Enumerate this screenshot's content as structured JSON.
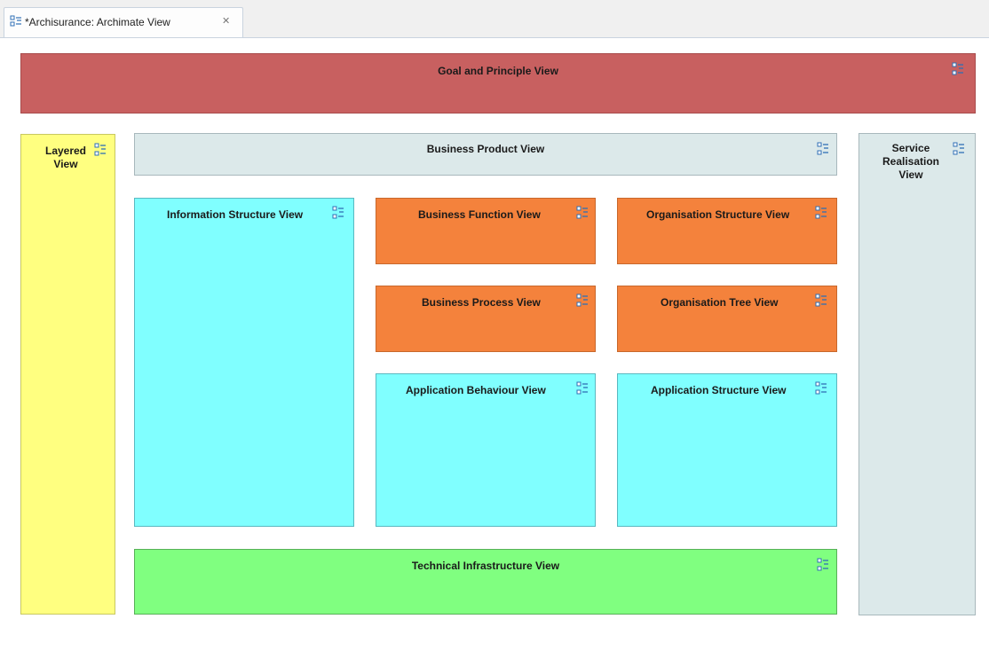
{
  "editor": {
    "tab_title": "*Archisurance: Archimate View",
    "tab_icon": "diagram-model-icon",
    "close_icon": "close-icon"
  },
  "diagram": {
    "goal_principle": "Goal and Principle View",
    "layered_line1": "Layered",
    "layered_line2": "View",
    "business_product": "Business Product View",
    "service_line1": "Service",
    "service_line2": "Realisation",
    "service_line3": "View",
    "information_structure": "Information Structure View",
    "business_function": "Business Function View",
    "organisation_structure": "Organisation Structure View",
    "business_process": "Business Process View",
    "organisation_tree": "Organisation Tree View",
    "application_behaviour": "Application Behaviour View",
    "application_structure": "Application Structure View",
    "technical_infrastructure": "Technical Infrastructure View"
  },
  "colors": {
    "motivation": "#c86060",
    "layered": "#ffff80",
    "business_product": "#dce9ea",
    "information_application": "#80ffff",
    "business": "#f4823c",
    "technology": "#80ff80"
  }
}
